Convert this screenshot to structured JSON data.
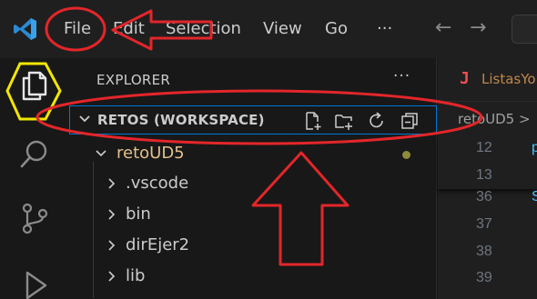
{
  "titlebar": {
    "menus": [
      {
        "label": "File"
      },
      {
        "label": "Edit"
      },
      {
        "label": "Selection"
      },
      {
        "label": "View"
      },
      {
        "label": "Go"
      },
      {
        "label": "···"
      }
    ],
    "back_glyph": "←",
    "forward_glyph": "→"
  },
  "sidebar": {
    "title": "EXPLORER",
    "more_glyph": "···",
    "workspace": {
      "label": "RETOS (WORKSPACE)"
    },
    "tree": [
      {
        "label": "retoUD5",
        "expanded": true
      },
      {
        "label": ".vscode",
        "expanded": false
      },
      {
        "label": "bin",
        "expanded": false
      },
      {
        "label": "dirEjer2",
        "expanded": false
      },
      {
        "label": "lib",
        "expanded": false
      }
    ]
  },
  "editor": {
    "tab_icon": "J",
    "tab_name": "ListasYo",
    "breadcrumb": "retoUD5 >",
    "sticky_lines": [
      "12",
      "13"
    ],
    "sticky_code": "p",
    "lines": [
      "36",
      "37",
      "38",
      "39"
    ],
    "line_code": "S"
  },
  "colors": {
    "annotation_red": "#e3262a",
    "highlight_yellow": "#f2e600",
    "focus_blue": "#0078d4",
    "modified_dot": "#8c8c3a"
  }
}
